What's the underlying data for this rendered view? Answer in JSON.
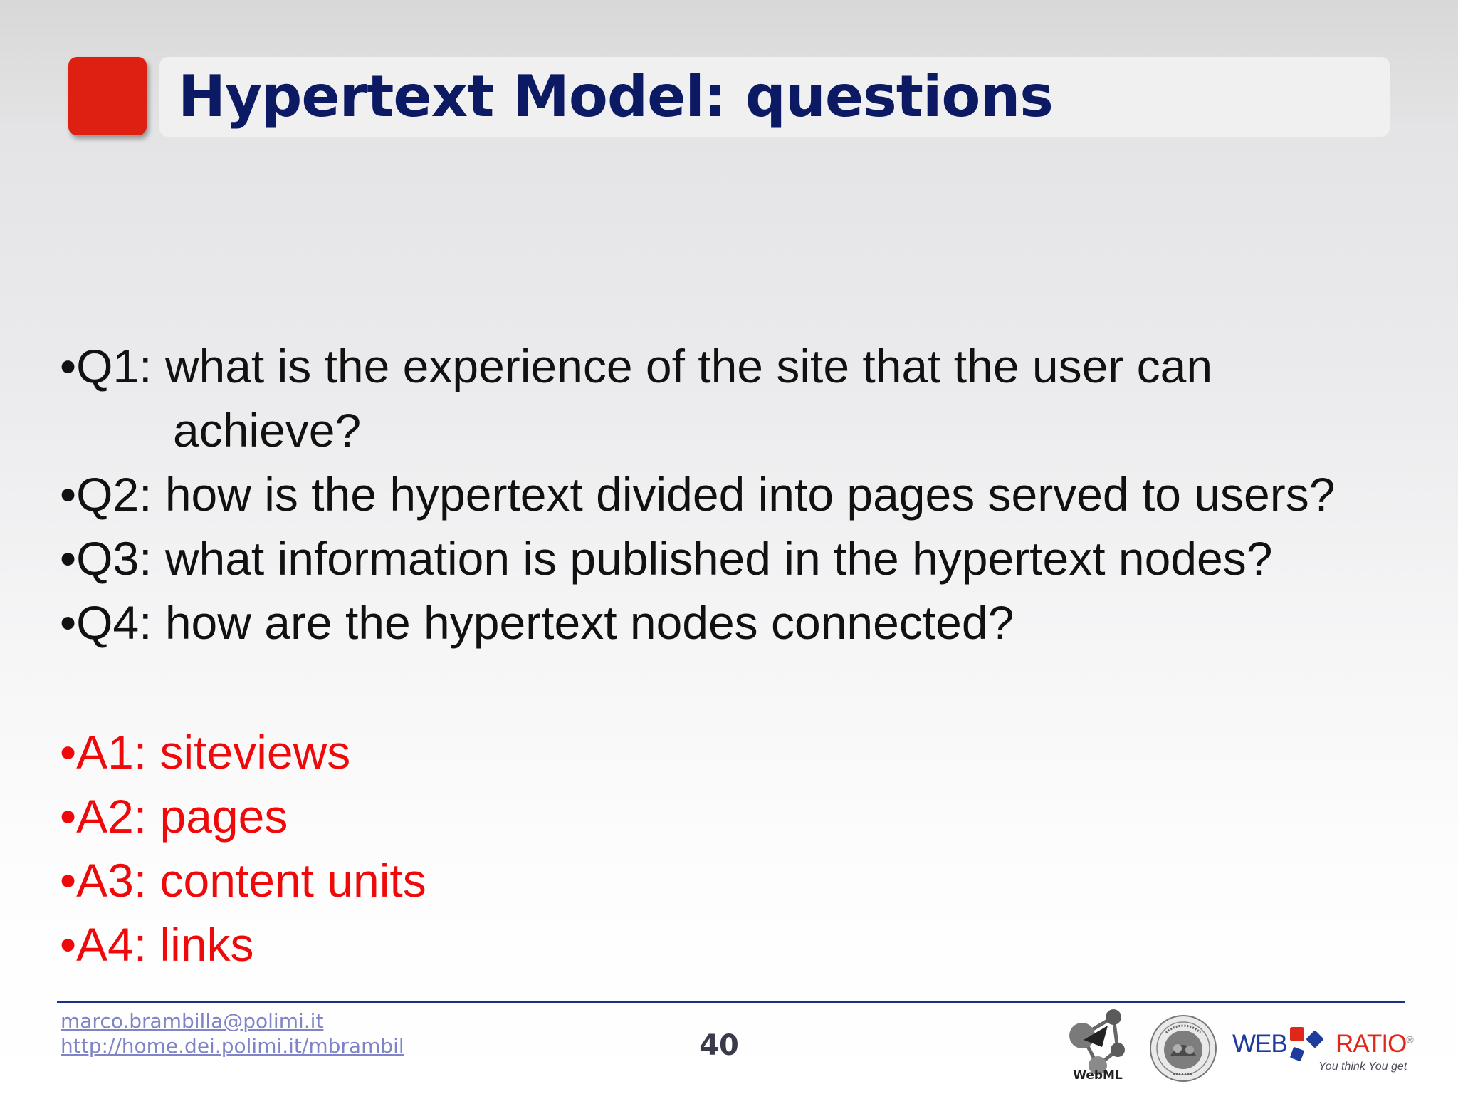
{
  "slide": {
    "title": "Hypertext Model: questions",
    "questions": [
      "•Q1: what is the experience of the site that the user can",
      "achieve?",
      "•Q2: how is the hypertext divided into pages served to users?",
      "•Q3: what information is published in the hypertext nodes?",
      "•Q4: how are the hypertext nodes connected?"
    ],
    "answers": [
      "•A1: siteviews",
      "•A2: pages",
      "•A3: content units",
      "•A4: links"
    ]
  },
  "footer": {
    "email": "marco.brambilla@polimi.it",
    "url": "http://home.dei.polimi.it/mbrambil",
    "page_number": "40",
    "logos": {
      "webml_label": "WebML",
      "webratio_web": "WEB",
      "webratio_ratio": "RATIO",
      "webratio_registered": "®",
      "webratio_tagline": "You think You get",
      "seal_ring_text": "POLITECNICO",
      "seal_bottom_text": "MILANO"
    }
  },
  "colors": {
    "title": "#0c1a64",
    "accent_square": "#dd2011",
    "answers": "#ee0a0a",
    "footer_rule": "#1b2f8a",
    "footer_link": "#7e84c6"
  }
}
